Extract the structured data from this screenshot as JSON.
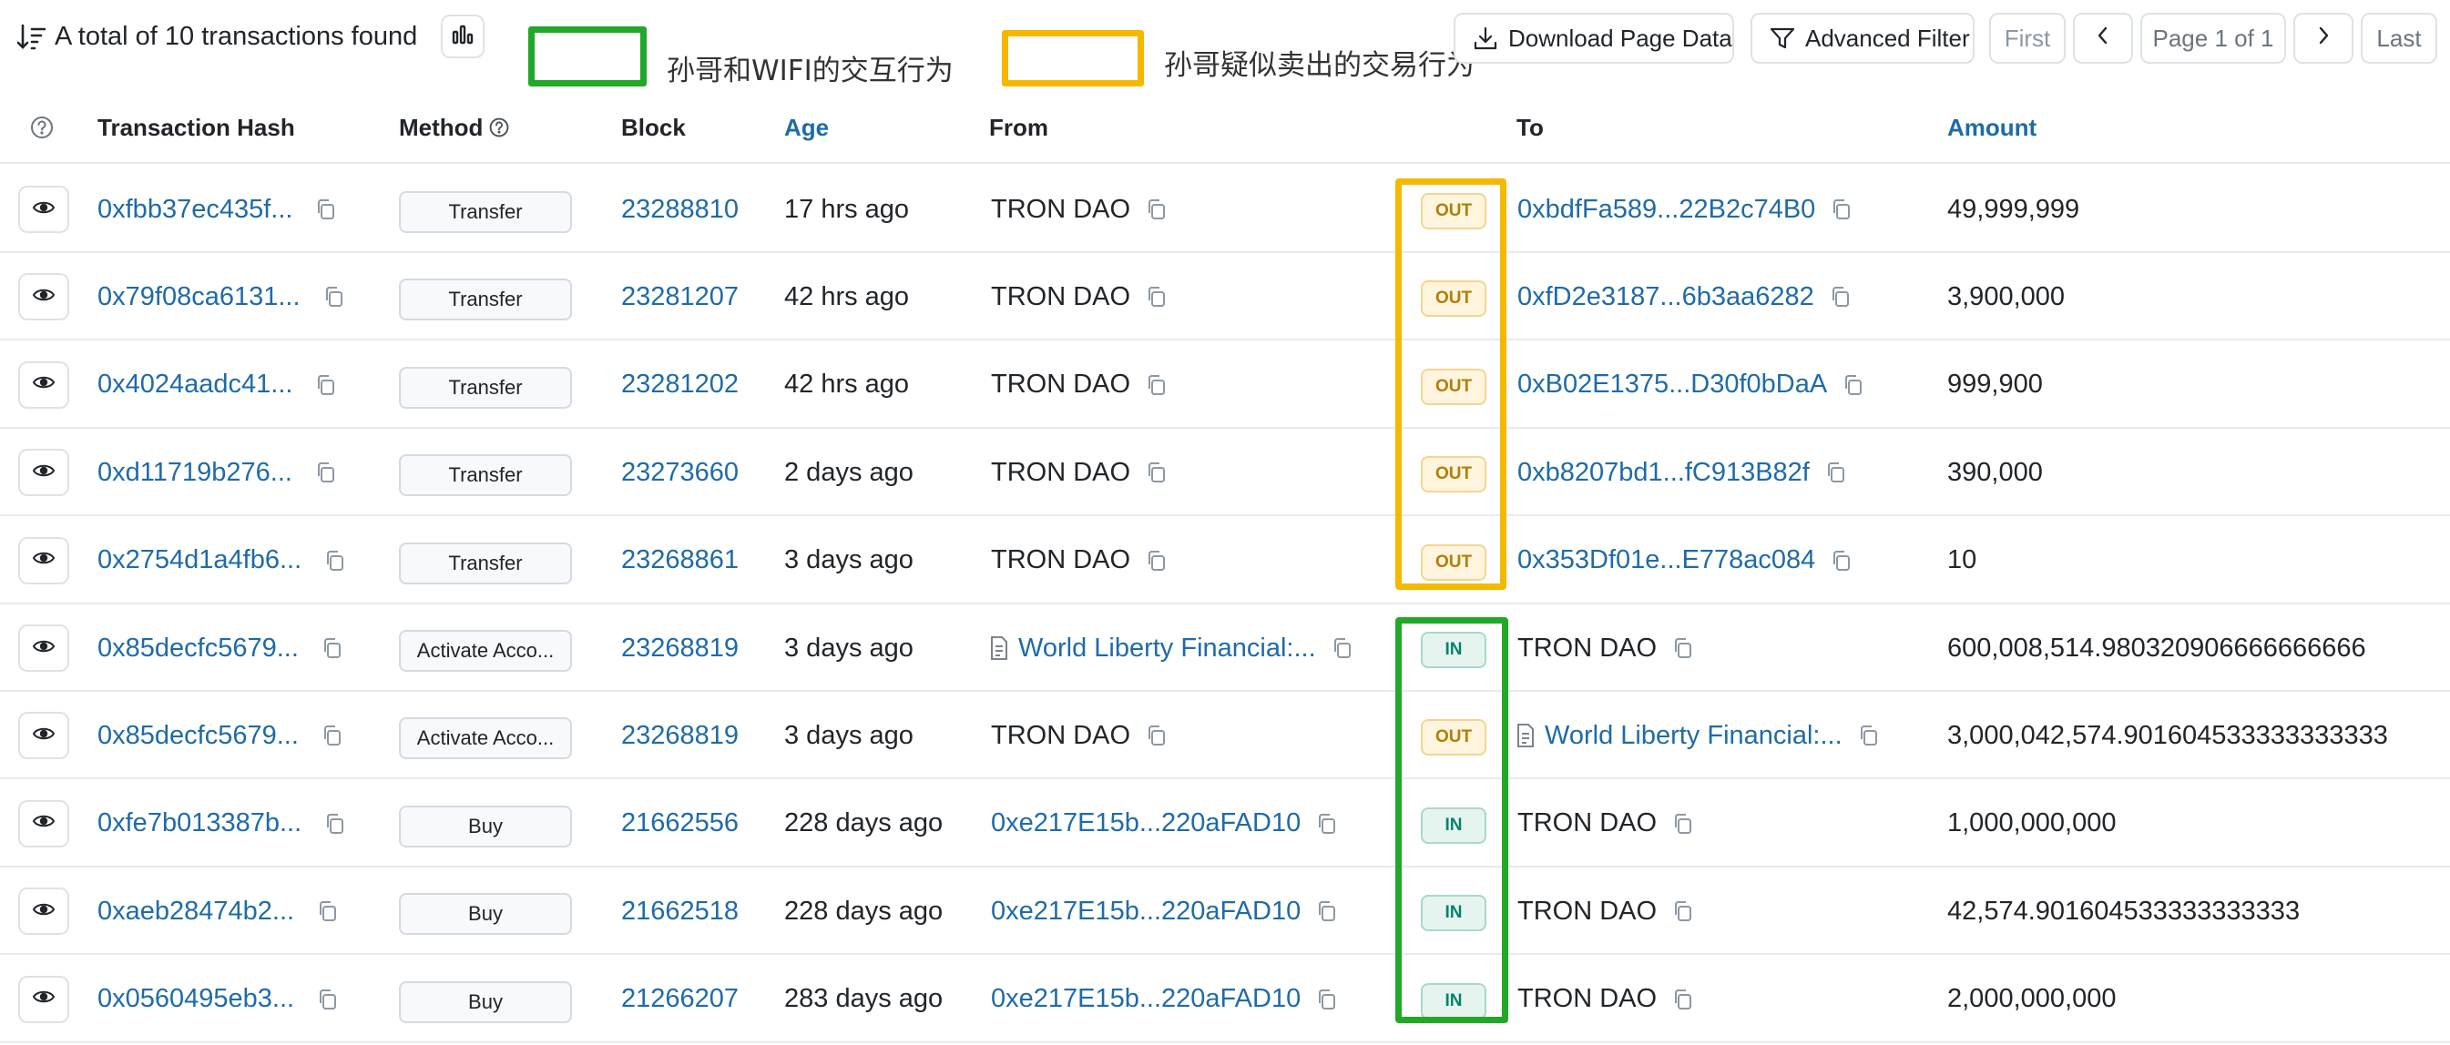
{
  "header": {
    "total_text": "A total of 10 transactions found",
    "download_label": "Download Page Data",
    "filter_label": "Advanced Filter",
    "first_label": "First",
    "page_label": "Page 1 of 1",
    "last_label": "Last"
  },
  "legend": {
    "green_label": "孙哥和WIFI的交互行为",
    "yellow_label": "孙哥疑似卖出的交易行为",
    "green_color": "#22a828",
    "yellow_color": "#f5b800"
  },
  "columns": {
    "hash": "Transaction Hash",
    "method": "Method",
    "block": "Block",
    "age": "Age",
    "from": "From",
    "to": "To",
    "amount": "Amount"
  },
  "rows": [
    {
      "hash": "0xfbb37ec435f...",
      "method": "Transfer",
      "block": "23288810",
      "age": "17 hrs ago",
      "from": "TRON DAO",
      "dir": "OUT",
      "to": "0xbdfFa589...22B2c74B0",
      "amount": "49,999,999"
    },
    {
      "hash": "0x79f08ca6131...",
      "method": "Transfer",
      "block": "23281207",
      "age": "42 hrs ago",
      "from": "TRON DAO",
      "dir": "OUT",
      "to": "0xfD2e3187...6b3aa6282",
      "amount": "3,900,000"
    },
    {
      "hash": "0x4024aadc41...",
      "method": "Transfer",
      "block": "23281202",
      "age": "42 hrs ago",
      "from": "TRON DAO",
      "dir": "OUT",
      "to": "0xB02E1375...D30f0bDaA",
      "amount": "999,900"
    },
    {
      "hash": "0xd11719b276...",
      "method": "Transfer",
      "block": "23273660",
      "age": "2 days ago",
      "from": "TRON DAO",
      "dir": "OUT",
      "to": "0xb8207bd1...fC913B82f",
      "amount": "390,000"
    },
    {
      "hash": "0x2754d1a4fb6...",
      "method": "Transfer",
      "block": "23268861",
      "age": "3 days ago",
      "from": "TRON DAO",
      "dir": "OUT",
      "to": "0x353Df01e...E778ac084",
      "amount": "10"
    },
    {
      "hash": "0x85decfc5679...",
      "method": "Activate Acco...",
      "block": "23268819",
      "age": "3 days ago",
      "from": "World Liberty Financial:...",
      "dir": "IN",
      "to": "TRON DAO",
      "amount": "600,008,514.980320906666666666"
    },
    {
      "hash": "0x85decfc5679...",
      "method": "Activate Acco...",
      "block": "23268819",
      "age": "3 days ago",
      "from": "TRON DAO",
      "dir": "OUT",
      "to": "World Liberty Financial:...",
      "amount": "3,000,042,574.901604533333333333"
    },
    {
      "hash": "0xfe7b013387b...",
      "method": "Buy",
      "block": "21662556",
      "age": "228 days ago",
      "from": "0xe217E15b...220aFAD10",
      "dir": "IN",
      "to": "TRON DAO",
      "amount": "1,000,000,000"
    },
    {
      "hash": "0xaeb28474b2...",
      "method": "Buy",
      "block": "21662518",
      "age": "228 days ago",
      "from": "0xe217E15b...220aFAD10",
      "dir": "IN",
      "to": "TRON DAO",
      "amount": "42,574.901604533333333333"
    },
    {
      "hash": "0x0560495eb3...",
      "method": "Buy",
      "block": "21266207",
      "age": "283 days ago",
      "from": "0xe217E15b...220aFAD10",
      "dir": "IN",
      "to": "TRON DAO",
      "amount": "2,000,000,000"
    }
  ]
}
